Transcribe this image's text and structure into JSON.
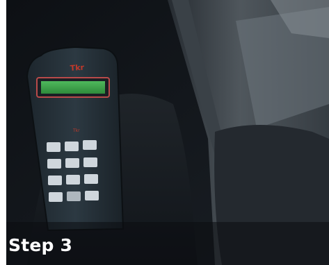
{
  "caption": {
    "step_label": "Step 3"
  },
  "photo": {
    "subject": "handheld-programmer-device-on-car-seat",
    "colors": {
      "background": "#0f1216",
      "seat": "#1b1f24",
      "trim": "#3b4248",
      "device_body": "#27323a",
      "screen": "#3fa34d",
      "screen_border": "#b94a4a",
      "key": "#cfd6dc",
      "logo": "#c0392b"
    }
  }
}
